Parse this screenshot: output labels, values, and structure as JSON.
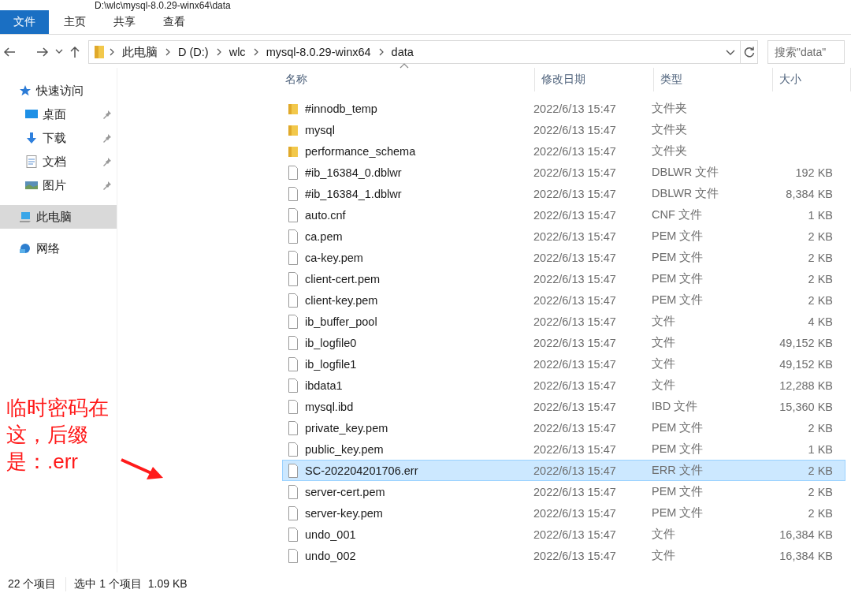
{
  "window": {
    "title": "D:\\wlc\\mysql-8.0.29-winx64\\data"
  },
  "ribbon_tabs": [
    {
      "label": "文件",
      "kind": "file"
    },
    {
      "label": "主页",
      "kind": "tab"
    },
    {
      "label": "共享",
      "kind": "tab"
    },
    {
      "label": "查看",
      "kind": "tab"
    }
  ],
  "address_bar": {
    "path": [
      "此电脑",
      "D (D:)",
      "wlc",
      "mysql-8.0.29-winx64",
      "data"
    ]
  },
  "search": {
    "placeholder": "搜索\"data\""
  },
  "sidebar": {
    "items": [
      {
        "label": "快速访问",
        "selected": false,
        "children": [
          {
            "label": "桌面",
            "pinned": true,
            "selected": false
          },
          {
            "label": "下载",
            "pinned": true,
            "selected": false
          },
          {
            "label": "文档",
            "pinned": true,
            "selected": false
          },
          {
            "label": "图片",
            "pinned": true,
            "selected": false
          }
        ]
      },
      {
        "label": "此电脑",
        "selected": true
      },
      {
        "label": "网络",
        "selected": false
      }
    ]
  },
  "table": {
    "columns": [
      "名称",
      "修改日期",
      "类型",
      "大小"
    ],
    "rows": [
      {
        "name": "#innodb_temp",
        "date": "2022/6/13 15:47",
        "type": "文件夹",
        "size": "",
        "kind": "folder",
        "selected": false
      },
      {
        "name": "mysql",
        "date": "2022/6/13 15:47",
        "type": "文件夹",
        "size": "",
        "kind": "folder",
        "selected": false
      },
      {
        "name": "performance_schema",
        "date": "2022/6/13 15:47",
        "type": "文件夹",
        "size": "",
        "kind": "folder",
        "selected": false
      },
      {
        "name": "#ib_16384_0.dblwr",
        "date": "2022/6/13 15:47",
        "type": "DBLWR 文件",
        "size": "192 KB",
        "kind": "file",
        "selected": false
      },
      {
        "name": "#ib_16384_1.dblwr",
        "date": "2022/6/13 15:47",
        "type": "DBLWR 文件",
        "size": "8,384 KB",
        "kind": "file",
        "selected": false
      },
      {
        "name": "auto.cnf",
        "date": "2022/6/13 15:47",
        "type": "CNF 文件",
        "size": "1 KB",
        "kind": "file",
        "selected": false
      },
      {
        "name": "ca.pem",
        "date": "2022/6/13 15:47",
        "type": "PEM 文件",
        "size": "2 KB",
        "kind": "file",
        "selected": false
      },
      {
        "name": "ca-key.pem",
        "date": "2022/6/13 15:47",
        "type": "PEM 文件",
        "size": "2 KB",
        "kind": "file",
        "selected": false
      },
      {
        "name": "client-cert.pem",
        "date": "2022/6/13 15:47",
        "type": "PEM 文件",
        "size": "2 KB",
        "kind": "file",
        "selected": false
      },
      {
        "name": "client-key.pem",
        "date": "2022/6/13 15:47",
        "type": "PEM 文件",
        "size": "2 KB",
        "kind": "file",
        "selected": false
      },
      {
        "name": "ib_buffer_pool",
        "date": "2022/6/13 15:47",
        "type": "文件",
        "size": "4 KB",
        "kind": "file",
        "selected": false
      },
      {
        "name": "ib_logfile0",
        "date": "2022/6/13 15:47",
        "type": "文件",
        "size": "49,152 KB",
        "kind": "file",
        "selected": false
      },
      {
        "name": "ib_logfile1",
        "date": "2022/6/13 15:47",
        "type": "文件",
        "size": "49,152 KB",
        "kind": "file",
        "selected": false
      },
      {
        "name": "ibdata1",
        "date": "2022/6/13 15:47",
        "type": "文件",
        "size": "12,288 KB",
        "kind": "file",
        "selected": false
      },
      {
        "name": "mysql.ibd",
        "date": "2022/6/13 15:47",
        "type": "IBD 文件",
        "size": "15,360 KB",
        "kind": "file",
        "selected": false
      },
      {
        "name": "private_key.pem",
        "date": "2022/6/13 15:47",
        "type": "PEM 文件",
        "size": "2 KB",
        "kind": "file",
        "selected": false
      },
      {
        "name": "public_key.pem",
        "date": "2022/6/13 15:47",
        "type": "PEM 文件",
        "size": "1 KB",
        "kind": "file",
        "selected": false
      },
      {
        "name": "SC-202204201706.err",
        "date": "2022/6/13 15:47",
        "type": "ERR 文件",
        "size": "2 KB",
        "kind": "file",
        "selected": true
      },
      {
        "name": "server-cert.pem",
        "date": "2022/6/13 15:47",
        "type": "PEM 文件",
        "size": "2 KB",
        "kind": "file",
        "selected": false
      },
      {
        "name": "server-key.pem",
        "date": "2022/6/13 15:47",
        "type": "PEM 文件",
        "size": "2 KB",
        "kind": "file",
        "selected": false
      },
      {
        "name": "undo_001",
        "date": "2022/6/13 15:47",
        "type": "文件",
        "size": "16,384 KB",
        "kind": "file",
        "selected": false
      },
      {
        "name": "undo_002",
        "date": "2022/6/13 15:47",
        "type": "文件",
        "size": "16,384 KB",
        "kind": "file",
        "selected": false
      }
    ]
  },
  "annotation": {
    "text": "临时密码在这，后缀是：.err"
  },
  "status_bar": {
    "item_count": "22 个项目",
    "selection": "选中 1 个项目  1.09 KB"
  }
}
